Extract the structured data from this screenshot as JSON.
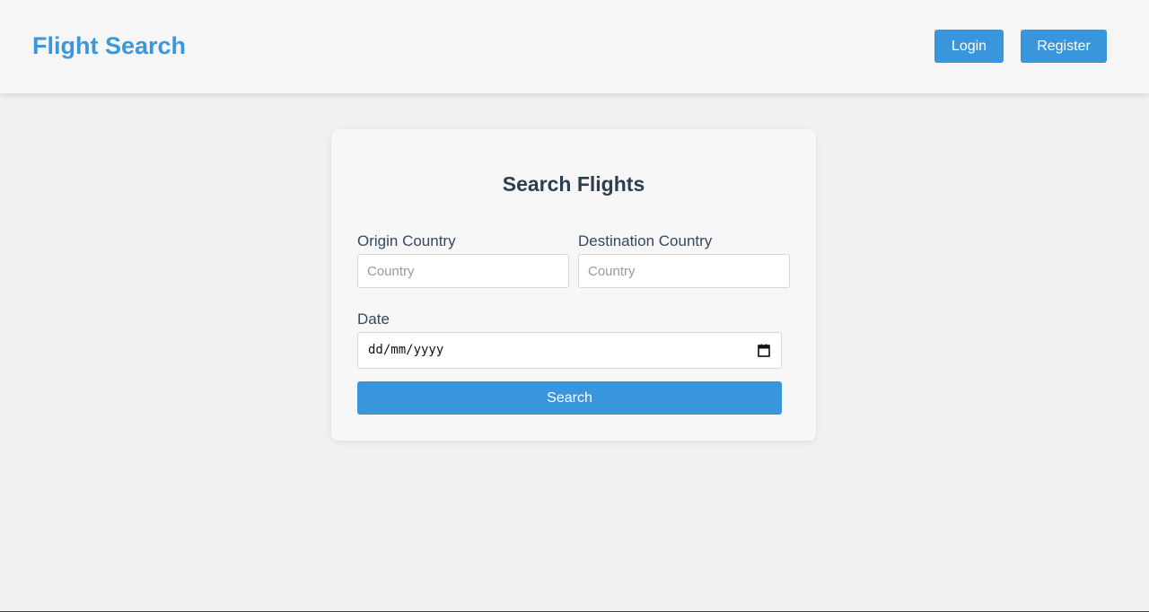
{
  "header": {
    "brand": "Flight Search",
    "login_label": "Login",
    "register_label": "Register"
  },
  "form": {
    "title": "Search Flights",
    "origin": {
      "label": "Origin Country",
      "placeholder": "Country",
      "value": ""
    },
    "destination": {
      "label": "Destination Country",
      "placeholder": "Country",
      "value": ""
    },
    "date": {
      "label": "Date",
      "value": "dd/mm/yyyy",
      "icon": "calendar-icon"
    },
    "search_label": "Search"
  },
  "colors": {
    "accent": "#3996dd",
    "brand": "#3a97da",
    "heading": "#2c3e50",
    "background": "#f1f1f1"
  }
}
